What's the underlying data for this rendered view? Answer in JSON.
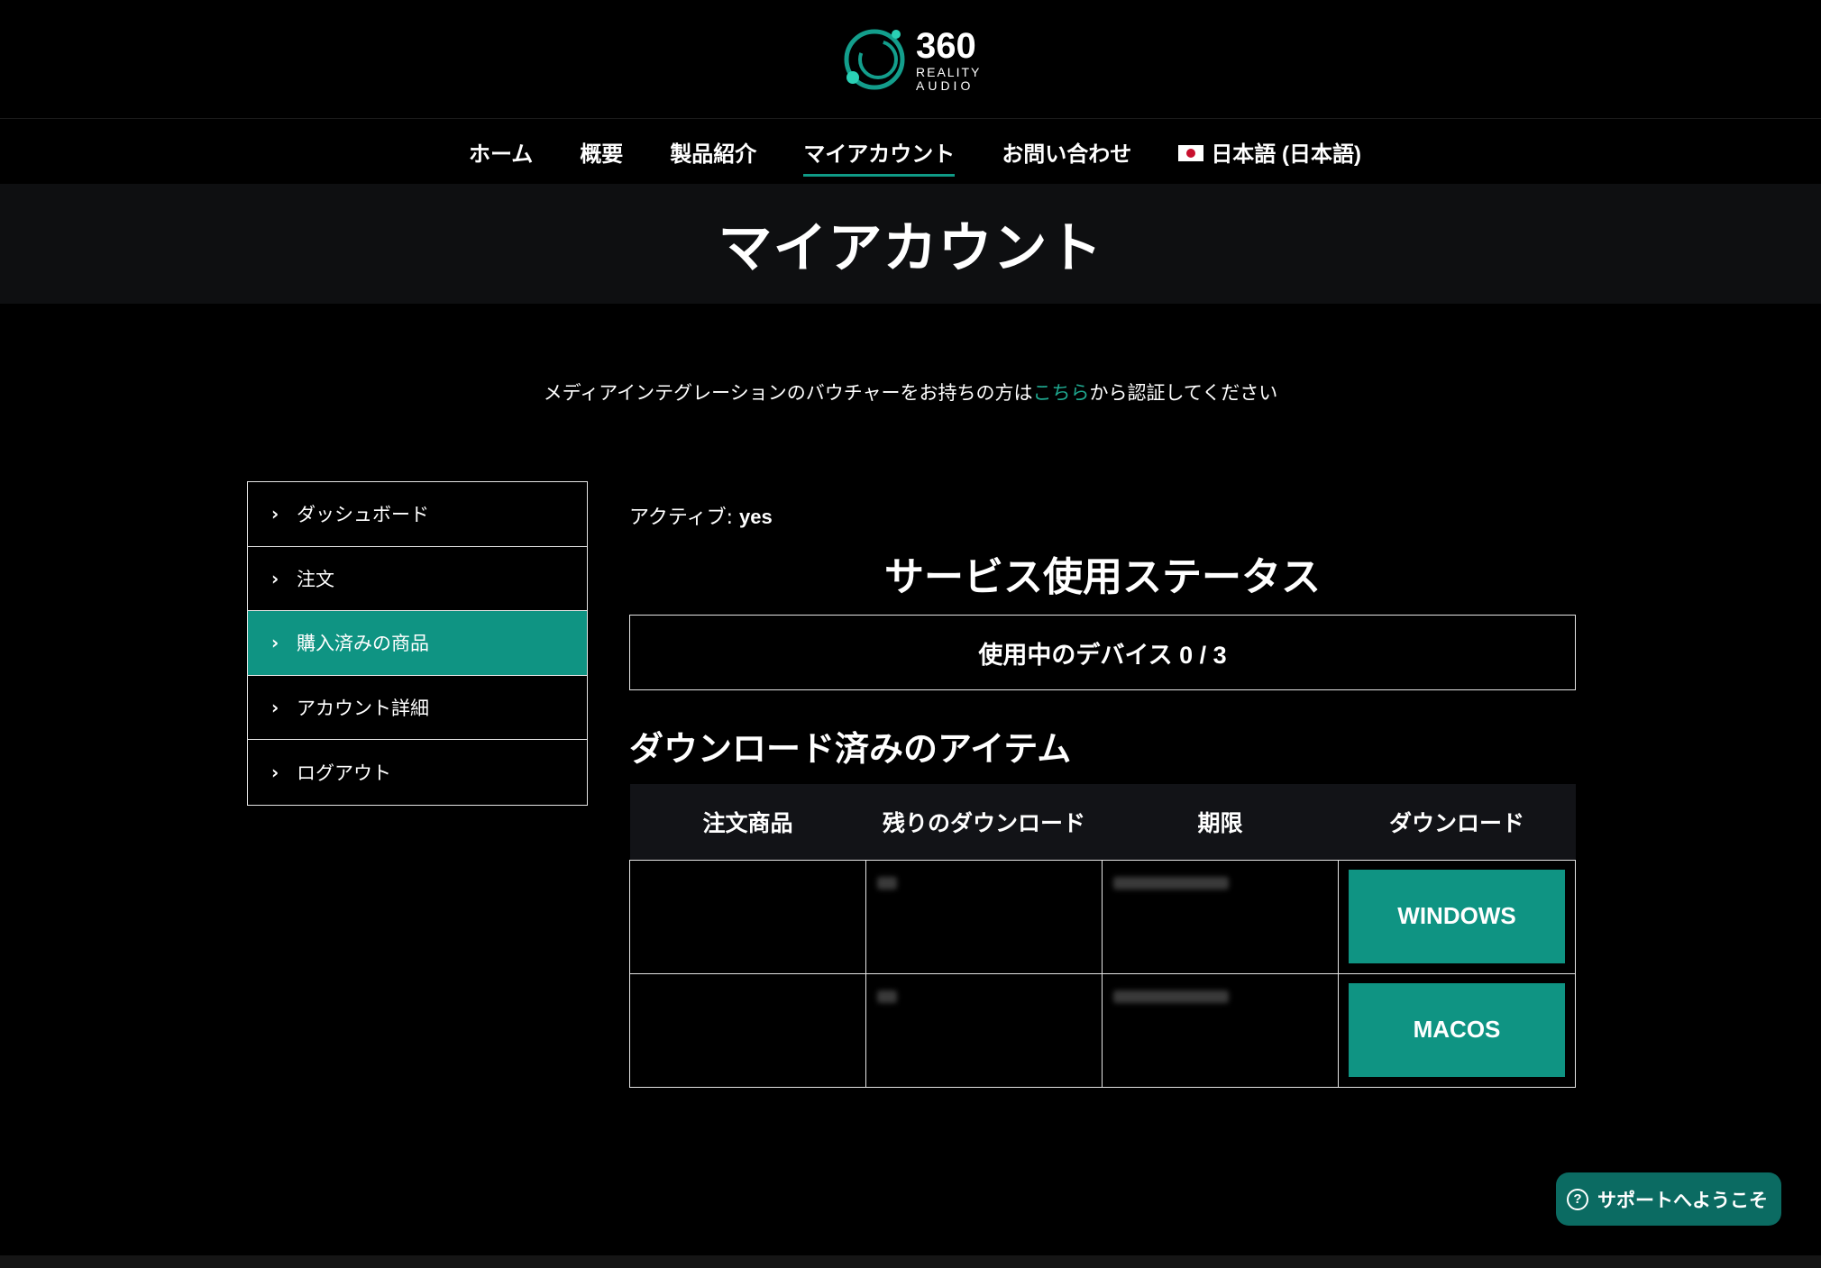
{
  "logo": {
    "number": "360",
    "line1": "REALITY",
    "line2": "AUDIO"
  },
  "nav": {
    "items": [
      {
        "label": "ホーム"
      },
      {
        "label": "概要"
      },
      {
        "label": "製品紹介"
      },
      {
        "label": "マイアカウント",
        "active": true
      },
      {
        "label": "お問い合わせ"
      }
    ],
    "language": "日本語 (日本語)"
  },
  "page": {
    "title": "マイアカウント"
  },
  "notice": {
    "before": "メディアインテグレーションのバウチャーをお持ちの方は",
    "link": "こちら",
    "after": "から認証してください"
  },
  "sidebar": {
    "items": [
      {
        "label": "ダッシュボード"
      },
      {
        "label": "注文"
      },
      {
        "label": "購入済みの商品",
        "active": true
      },
      {
        "label": "アカウント詳細"
      },
      {
        "label": "ログアウト"
      }
    ]
  },
  "main": {
    "active_label": "アクティブ: ",
    "active_value": "yes",
    "status_title": "サービス使用ステータス",
    "devices": "使用中のデバイス 0 / 3",
    "downloads_title": "ダウンロード済みのアイテム",
    "table": {
      "headers": [
        "注文商品",
        "残りのダウンロード",
        "期限",
        "ダウンロード"
      ],
      "rows": [
        {
          "button": "WINDOWS"
        },
        {
          "button": "MACOS"
        }
      ]
    }
  },
  "support": {
    "label": "サポートへようこそ"
  },
  "colors": {
    "accent": "#0f9483",
    "link": "#1fa88f",
    "background": "#000000"
  }
}
